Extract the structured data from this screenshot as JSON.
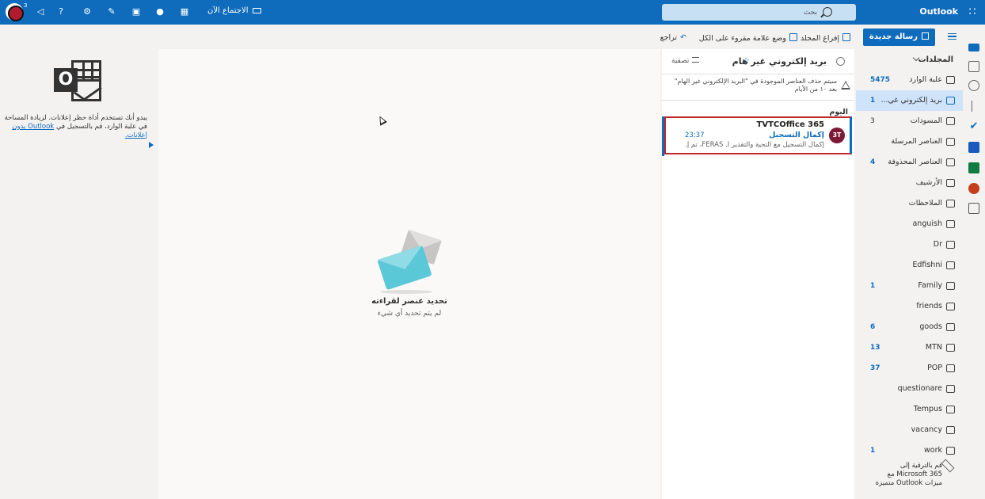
{
  "topbar": {
    "app_name": "Outlook",
    "search_placeholder": "بحث",
    "meet_now": "الاجتماع الآن",
    "notification_count": "3",
    "help_icon": "?"
  },
  "commands": {
    "new_message": "رسالة جديدة",
    "empty_folder": "إفراغ المجلد",
    "mark_all_read": "وضع علامة مقروء على الكل",
    "undo": "تراجع"
  },
  "folders": {
    "header": "المجلدات",
    "items": [
      {
        "label": "علبة الوارد",
        "count": "5475",
        "count_style": "blue",
        "icon": "inbox-icon"
      },
      {
        "label": "بريد إلكتروني غي...",
        "count": "1",
        "count_style": "blue",
        "icon": "junk-icon",
        "selected": true
      },
      {
        "label": "المسودات",
        "count": "3",
        "count_style": "plain",
        "icon": "drafts-icon"
      },
      {
        "label": "العناصر المرسلة",
        "count": "",
        "count_style": "plain",
        "icon": "sent-icon"
      },
      {
        "label": "العناصر المحذوفة",
        "count": "4",
        "count_style": "blue",
        "icon": "deleted-icon"
      },
      {
        "label": "الأرشيف",
        "count": "",
        "count_style": "plain",
        "icon": "archive-icon"
      },
      {
        "label": "الملاحظات",
        "count": "",
        "count_style": "plain",
        "icon": "notes-icon"
      },
      {
        "label": "anguish",
        "count": "",
        "count_style": "plain",
        "icon": "folder-icon"
      },
      {
        "label": "Dr",
        "count": "",
        "count_style": "plain",
        "icon": "folder-icon"
      },
      {
        "label": "Edfishni",
        "count": "",
        "count_style": "plain",
        "icon": "folder-icon"
      },
      {
        "label": "Family",
        "count": "1",
        "count_style": "blue",
        "icon": "folder-icon"
      },
      {
        "label": "friends",
        "count": "",
        "count_style": "plain",
        "icon": "folder-icon"
      },
      {
        "label": "goods",
        "count": "6",
        "count_style": "blue",
        "icon": "folder-icon"
      },
      {
        "label": "MTN",
        "count": "13",
        "count_style": "blue",
        "icon": "folder-icon"
      },
      {
        "label": "POP",
        "count": "37",
        "count_style": "blue",
        "icon": "folder-icon"
      },
      {
        "label": "questionare",
        "count": "",
        "count_style": "plain",
        "icon": "folder-icon"
      },
      {
        "label": "Tempus",
        "count": "",
        "count_style": "plain",
        "icon": "folder-icon"
      },
      {
        "label": "vacancy",
        "count": "",
        "count_style": "plain",
        "icon": "folder-icon"
      },
      {
        "label": "work",
        "count": "1",
        "count_style": "blue",
        "icon": "folder-icon"
      }
    ],
    "upgrade_lines": [
      "قم بالترقية إلى",
      "Microsoft 365 مع",
      "ميزات Outlook متميزة"
    ]
  },
  "message_list": {
    "title": "بريد إلكتروني غير هام",
    "filter": "تصفية",
    "notice": "سيتم حذف العناصر الموجودة في \"البريد الإلكتروني غير الهام\" بعد ١٠ من الأيام",
    "group": "اليوم",
    "messages": [
      {
        "avatar": "3T",
        "from": "TVTCOffice 365",
        "subject": "إكمال التسجيل",
        "time": "23:37",
        "preview": "إكمال التسجيل مع التحية والتقدير أ. FERAS، تم إ..."
      }
    ]
  },
  "reading_pane": {
    "title": "تحديد عنصر لقراءته",
    "subtitle": "لم يتم تحديد أي شيء"
  },
  "ad": {
    "text": "يبدو أنك تستخدم أداة حظر إعلانات. لزيادة المساحة في علبة الوارد، قم بالتسجيل في",
    "link": "Outlook بدون إعلانات.",
    "logo_letter": "O"
  },
  "colors": {
    "brand": "#0f6cbd",
    "selected_folder": "#cfe4fa",
    "highlight_border": "#c0262d",
    "avatar": "#7b1a35"
  }
}
